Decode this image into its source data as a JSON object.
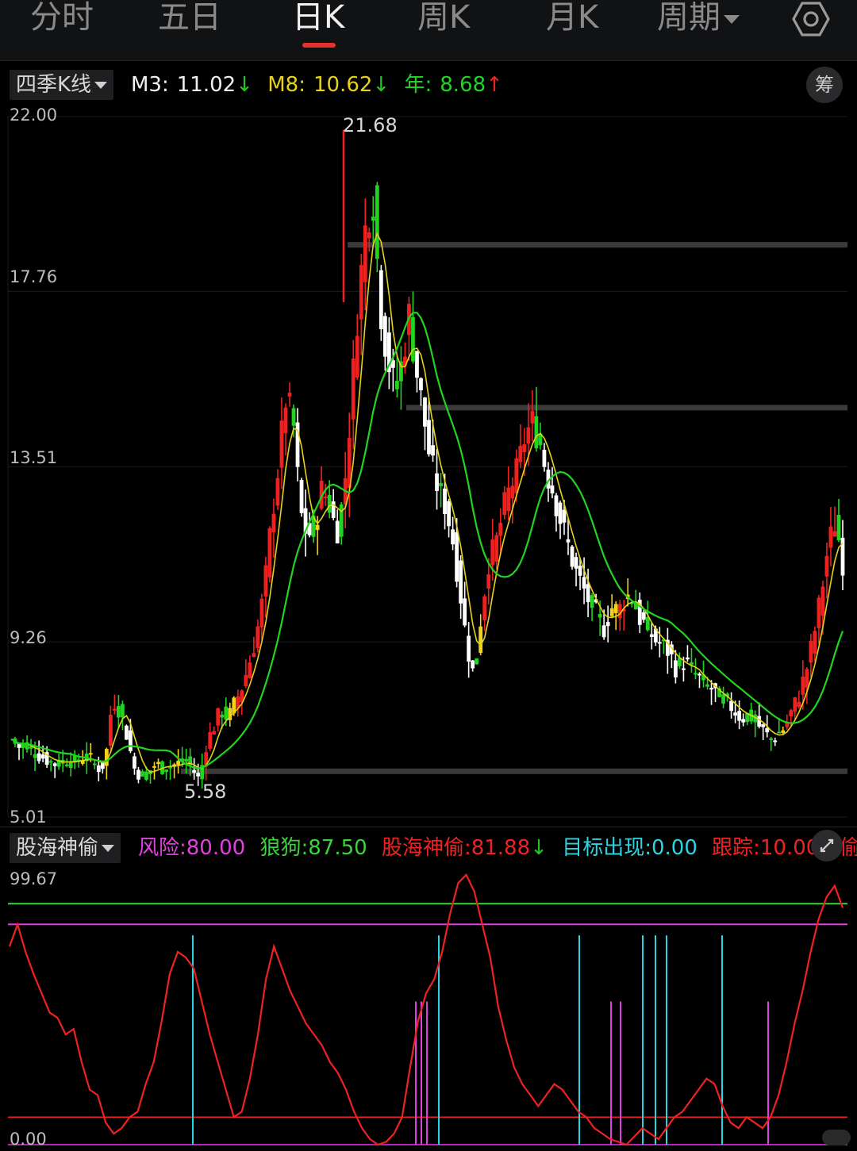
{
  "tabs": {
    "fenshi": "分时",
    "wuri": "五日",
    "rik": "日K",
    "zhouk": "周K",
    "yuek": "月K",
    "zhouqi": "周期"
  },
  "main_indicator": {
    "name": "四季K线",
    "m3_label": "M3:",
    "m3_value": "11.02",
    "m3_arrow": "↓",
    "m8_label": "M8:",
    "m8_value": "10.62",
    "m8_arrow": "↓",
    "nian_label": "年:",
    "nian_value": "8.68",
    "nian_arrow": "↑",
    "chip_label": "筹"
  },
  "price_axis": {
    "top": "22.00",
    "l1": "17.76",
    "l2": "13.51",
    "l3": "9.26",
    "bottom": "5.01"
  },
  "price_annotations": {
    "high": "21.68",
    "low": "5.58"
  },
  "sub_indicator": {
    "name": "股海神偷",
    "risk_label": "风险:",
    "risk_value": "80.00",
    "wolf_label": "狼狗:",
    "wolf_value": "87.50",
    "thief_label": "股海神偷:",
    "thief_value": "81.88",
    "thief_arrow": "↓",
    "target_label": "目标出现:",
    "target_value": "0.00",
    "track_label": "跟踪:",
    "track_value": "10.00",
    "overflow_label": "神偷"
  },
  "sub_axis": {
    "top": "99.67",
    "bottom": "0.00"
  },
  "colors": {
    "up": "#ee2020",
    "down_white": "#ffffff",
    "yellow": "#f2d21b",
    "green": "#22d322",
    "m8": "#e6d21a",
    "m3": "#ffffff",
    "nian": "#22d322",
    "risk": "#e040e0",
    "wolf": "#3bd33b",
    "thief": "#ee2222",
    "target": "#2ad4e0",
    "track": "#ee2222"
  },
  "chart_data": {
    "type": "candlestick",
    "y_range": [
      5.01,
      22.0
    ],
    "y_ticks": [
      22.0,
      17.76,
      13.51,
      9.26,
      5.01
    ],
    "high_marker": 21.68,
    "low_marker": 5.58,
    "close_path": [
      6.9,
      6.7,
      6.8,
      6.6,
      6.5,
      6.4,
      6.3,
      6.35,
      6.4,
      6.3,
      6.5,
      6.4,
      6.2,
      6.3,
      7.9,
      7.6,
      7.0,
      6.2,
      6.0,
      6.1,
      6.3,
      6.2,
      6.25,
      6.3,
      6.4,
      6.2,
      5.9,
      6.8,
      7.2,
      7.6,
      7.4,
      7.8,
      8.2,
      8.8,
      9.5,
      10.5,
      12.2,
      13.6,
      15.2,
      14.6,
      12.4,
      11.8,
      12.1,
      13.0,
      12.6,
      11.9,
      12.8,
      15.0,
      17.5,
      19.3,
      20.2,
      17.5,
      16.2,
      15.4,
      16.0,
      17.2,
      15.9,
      14.8,
      13.6,
      13.0,
      12.6,
      11.8,
      10.6,
      9.2,
      8.4,
      9.9,
      11.2,
      11.6,
      12.4,
      13.0,
      13.4,
      14.2,
      14.6,
      14.2,
      13.4,
      12.9,
      12.2,
      11.6,
      11.0,
      10.6,
      10.2,
      9.9,
      9.6,
      10.1,
      10.0,
      10.4,
      10.3,
      9.8,
      9.6,
      9.3,
      9.2,
      9.0,
      8.6,
      8.8,
      8.6,
      8.4,
      8.2,
      8.1,
      7.9,
      7.8,
      7.6,
      7.4,
      7.5,
      7.3,
      7.1,
      6.9,
      7.0,
      7.2,
      7.6,
      8.0,
      8.6,
      9.4,
      10.4,
      11.6,
      12.2,
      11.2
    ]
  },
  "sub_chart_data": {
    "type": "line",
    "y_range": [
      0.0,
      99.67
    ],
    "series": [
      {
        "name": "风险",
        "value": 80.0
      },
      {
        "name": "狼狗",
        "value": 87.5
      },
      {
        "name": "股海神偷",
        "value": 81.88
      },
      {
        "name": "目标出现",
        "value": 0.0
      },
      {
        "name": "跟踪",
        "value": 10.0
      }
    ]
  }
}
